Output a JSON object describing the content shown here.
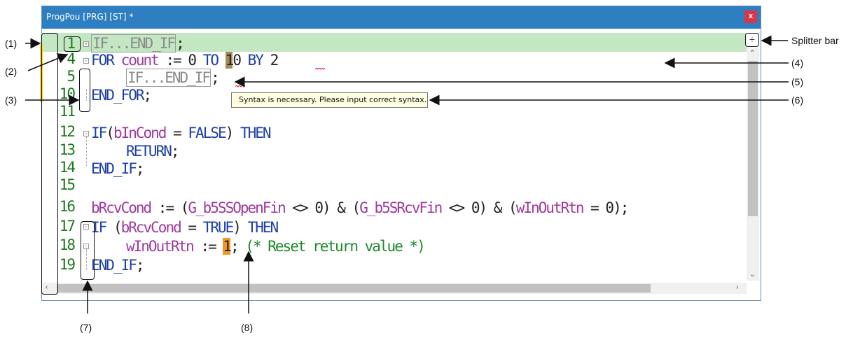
{
  "window": {
    "title": "ProgPou [PRG] [ST] *",
    "close_label": "x"
  },
  "splitter_icon": "splitter-bar-icon",
  "tooltip": "Syntax is necessary. Please input correct syntax.",
  "lines": {
    "l1": {
      "num": "1",
      "a": "IF...END_IF",
      "b": ";"
    },
    "l4": {
      "num": "4",
      "kw1": "FOR",
      "var": "count",
      "op": ":=",
      "n0": "0",
      "kw2": "TO",
      "n1": "1",
      "n2": "0",
      "kw3": "BY",
      "n3": "2"
    },
    "l5": {
      "num": "5",
      "a": "IF...END_IF",
      "b": ";"
    },
    "l10": {
      "num": "10",
      "kw": "END_FOR",
      "b": ";"
    },
    "l11": {
      "num": "11"
    },
    "l12": {
      "num": "12",
      "kw1": "IF",
      "p1": "(",
      "var": "bInCond",
      "op": " = ",
      "val": "FALSE",
      "p2": ")",
      "kw2": "THEN"
    },
    "l13": {
      "num": "13",
      "kw": "RETURN",
      "b": ";"
    },
    "l14": {
      "num": "14",
      "kw": "END_IF",
      "b": ";"
    },
    "l15": {
      "num": "15"
    },
    "l16": {
      "num": "16",
      "v1": "bRcvCond",
      "t1": " := (",
      "v2": "G_b5SSOpenFin",
      "t2": " <> 0) & (",
      "v3": "G_b5SRcvFin",
      "t3": " <> 0) & (",
      "v4": "wInOutRtn",
      "t4": " = 0);"
    },
    "l17": {
      "num": "17",
      "kw1": "IF",
      "t1": " (",
      "var": "bRcvCond",
      "t2": " = ",
      "val": "TRUE",
      "t3": ") ",
      "kw2": "THEN"
    },
    "l18": {
      "num": "18",
      "var": "wInOutRtn",
      "op": " := ",
      "lit": "1",
      "semi": ";",
      "cmt": "(* Reset return value *)"
    },
    "l19": {
      "num": "19",
      "kw": "END_IF",
      "b": ";"
    }
  },
  "callouts": {
    "c1": "(1)",
    "c2": "(2)",
    "c3": "(3)",
    "c4": "(4)",
    "c5": "(5)",
    "c6": "(6)",
    "c7": "(7)",
    "c8": "(8)",
    "splitter": "Splitter bar"
  }
}
